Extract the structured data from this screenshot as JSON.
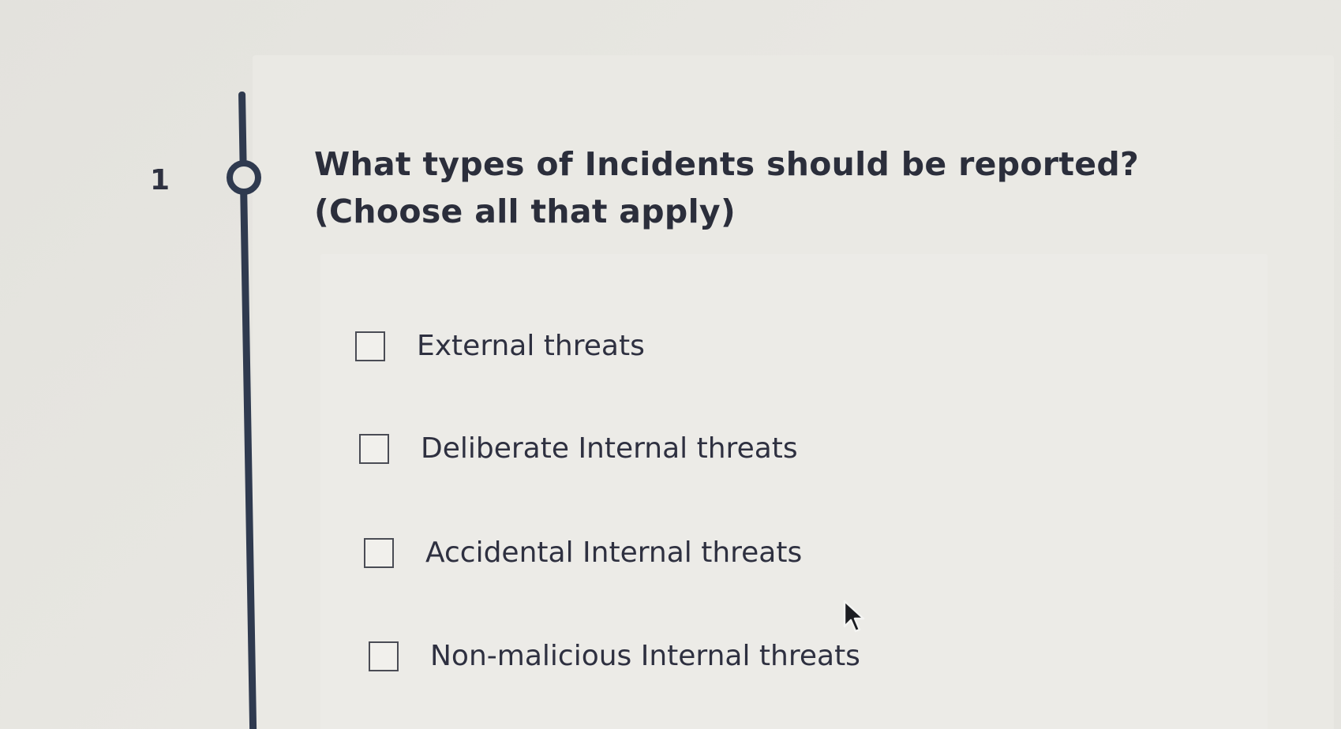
{
  "question": {
    "number": "1",
    "title": "What types of Incidents should be reported? (Choose all that apply)"
  },
  "options": [
    {
      "label": "External threats",
      "checked": false
    },
    {
      "label": "Deliberate Internal threats",
      "checked": false
    },
    {
      "label": "Accidental Internal threats",
      "checked": false
    },
    {
      "label": "Non-malicious Internal threats",
      "checked": false
    }
  ],
  "icons": {
    "timeline_node": "circle-node-icon",
    "pointer": "mouse-pointer-icon"
  },
  "colors": {
    "accent": "#2f3a4f",
    "text": "#2e3040",
    "background": "#e8e7e2"
  }
}
